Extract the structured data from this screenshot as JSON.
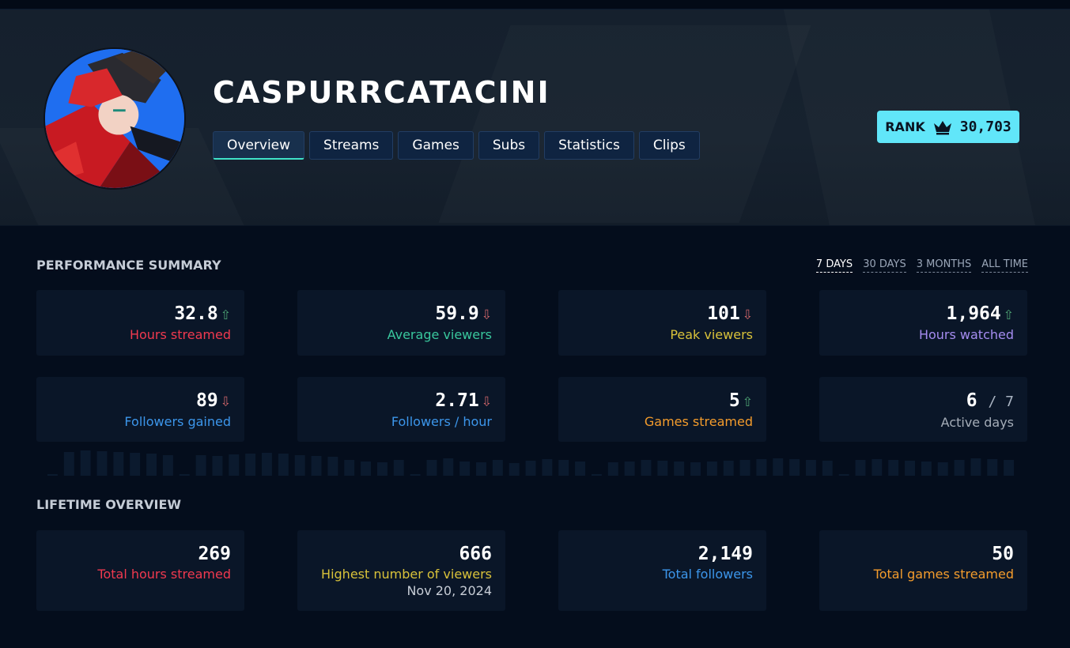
{
  "channel": {
    "name": "CASPURRCATACINI",
    "rank_label": "RANK",
    "rank_value": "30,703"
  },
  "nav": {
    "tabs": [
      {
        "label": "Overview",
        "active": true
      },
      {
        "label": "Streams"
      },
      {
        "label": "Games"
      },
      {
        "label": "Subs"
      },
      {
        "label": "Statistics"
      },
      {
        "label": "Clips"
      }
    ]
  },
  "performance": {
    "title": "PERFORMANCE SUMMARY",
    "ranges": [
      {
        "label": "7 DAYS",
        "active": true
      },
      {
        "label": "30 DAYS"
      },
      {
        "label": "3 MONTHS"
      },
      {
        "label": "ALL TIME"
      }
    ],
    "stats": [
      {
        "value": "32.8",
        "trend": "up",
        "label": "Hours streamed",
        "color": "#f0394f"
      },
      {
        "value": "59.9",
        "trend": "down",
        "label": "Average viewers",
        "color": "#39c79d"
      },
      {
        "value": "101",
        "trend": "down",
        "label": "Peak viewers",
        "color": "#d9c23a"
      },
      {
        "value": "1,964",
        "trend": "up",
        "label": "Hours watched",
        "color": "#a58cf0"
      },
      {
        "value": "89",
        "trend": "down",
        "label": "Followers gained",
        "color": "#3c96eb"
      },
      {
        "value": "2.71",
        "trend": "down",
        "label": "Followers / hour",
        "color": "#3c96eb"
      },
      {
        "value": "5",
        "trend": "up",
        "label": "Games streamed",
        "color": "#f49c2c"
      },
      {
        "value": "6",
        "denominator": "/ 7",
        "label": "Active days",
        "color": "#a5adb8"
      }
    ]
  },
  "lifetime": {
    "title": "LIFETIME OVERVIEW",
    "stats": [
      {
        "value": "269",
        "label": "Total hours streamed",
        "color": "#f0394f"
      },
      {
        "value": "666",
        "label": "Highest number of viewers",
        "sub": "Nov 20, 2024",
        "color": "#d9c23a"
      },
      {
        "value": "2,149",
        "label": "Total followers",
        "color": "#3c96eb"
      },
      {
        "value": "50",
        "label": "Total games streamed",
        "color": "#f49c2c"
      }
    ]
  },
  "icons": {
    "arrow_up": "⇧",
    "arrow_down": "⇩",
    "rank": "crown-icon"
  },
  "colors": {
    "background": "#040d1c",
    "card": "#0a1628",
    "rank_badge": "#61e6f9",
    "active_tab_underline": "#3fe2c8"
  }
}
